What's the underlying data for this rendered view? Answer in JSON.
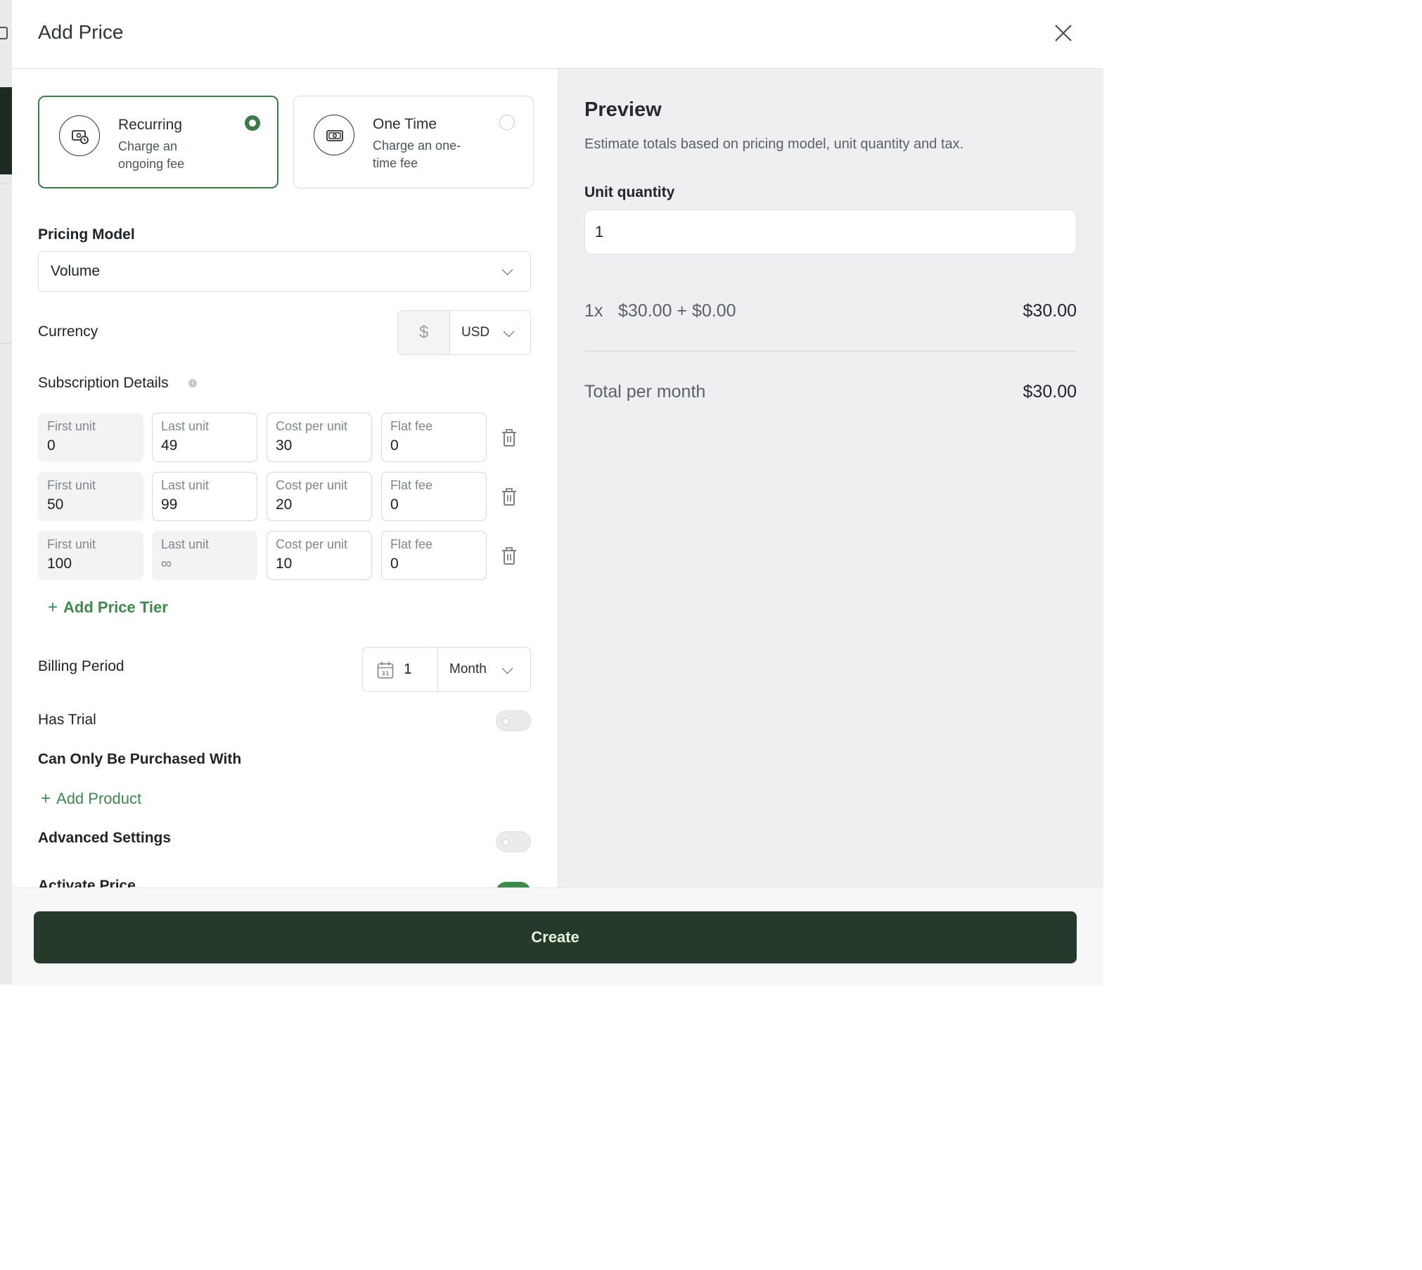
{
  "modal": {
    "title": "Add Price",
    "close_icon": "close-icon"
  },
  "price_types": [
    {
      "title": "Recurring",
      "description": "Charge an ongoing fee",
      "selected": true,
      "icon": "recurring-money-icon"
    },
    {
      "title": "One Time",
      "description": "Charge an one-time fee",
      "selected": false,
      "icon": "banknote-icon"
    }
  ],
  "pricing_model": {
    "label": "Pricing Model",
    "value": "Volume"
  },
  "currency": {
    "label": "Currency",
    "symbol": "$",
    "code": "USD"
  },
  "subscription_details": {
    "label": "Subscription Details",
    "info_icon": "info-icon",
    "columns": [
      "First unit",
      "Last unit",
      "Cost per unit",
      "Flat fee"
    ],
    "tiers": [
      {
        "first_unit": "0",
        "last_unit": "49",
        "cost_per_unit": "30",
        "flat_fee": "0"
      },
      {
        "first_unit": "50",
        "last_unit": "99",
        "cost_per_unit": "20",
        "flat_fee": "0"
      },
      {
        "first_unit": "100",
        "last_unit": "∞",
        "cost_per_unit": "10",
        "flat_fee": "0"
      }
    ],
    "add_tier_label": "Add Price Tier"
  },
  "billing_period": {
    "label": "Billing Period",
    "count": "1",
    "unit": "Month"
  },
  "has_trial": {
    "label": "Has Trial",
    "enabled": false
  },
  "purchase_with": {
    "label": "Can Only Be Purchased With",
    "add_label": "Add Product"
  },
  "advanced_settings": {
    "label": "Advanced Settings",
    "enabled": false
  },
  "activate_price": {
    "label": "Activate Price",
    "enabled": true
  },
  "preview": {
    "title": "Preview",
    "subtitle": "Estimate totals based on pricing model, unit quantity and tax.",
    "unit_quantity_label": "Unit quantity",
    "unit_quantity": "1",
    "line_qty": "1x",
    "line_calc": "$30.00 + $0.00",
    "line_amount": "$30.00",
    "total_label": "Total per month",
    "total_amount": "$30.00"
  },
  "footer": {
    "create_label": "Create"
  },
  "colors": {
    "accent": "#3c7a48",
    "link": "#3c8a4c",
    "button": "#263a2b",
    "preview_bg": "#efeff1"
  }
}
